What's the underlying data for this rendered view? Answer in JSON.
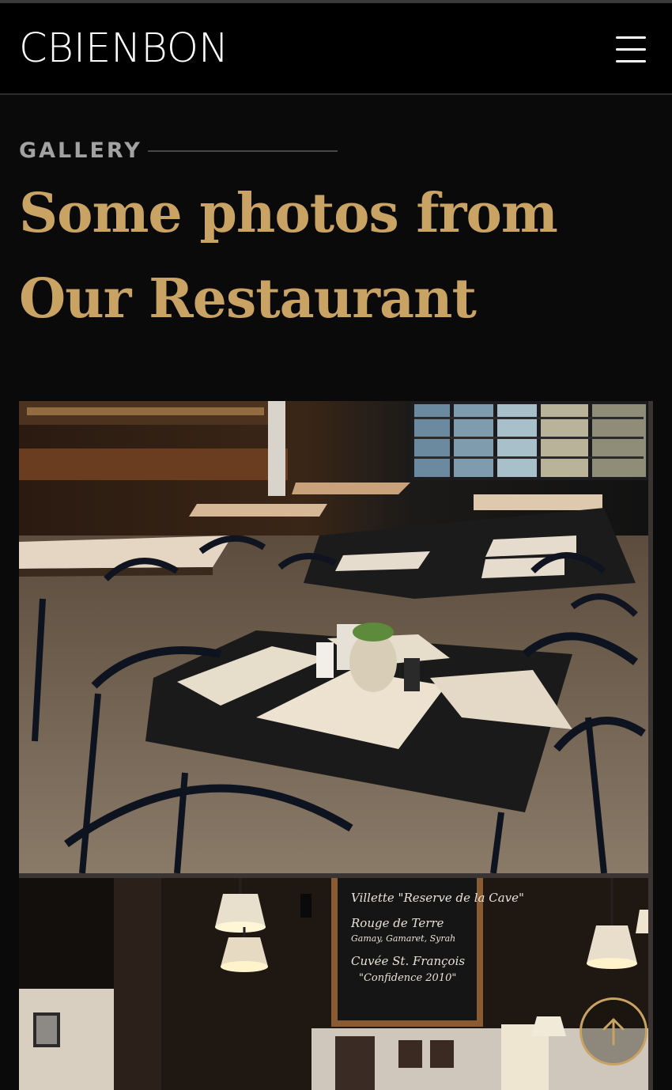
{
  "header": {
    "logo_text": "CBIENBON",
    "menu_icon": "hamburger-menu-icon"
  },
  "gallery_section": {
    "label": "GALLERY",
    "title": "Some photos from Our Restaurant",
    "photos": [
      {
        "alt": "Restaurant dining room with black tables, chairs and paper menus"
      },
      {
        "alt": "Restaurant interior with hanging lamps and chalkboard menu",
        "chalkboard_lines": [
          "Villette \"Reserve de la Cave\"",
          "Rouge de Terre",
          "Gamay, Gamaret, Syrah",
          "Cuvée St. François",
          "\"Confidence 2010\""
        ]
      }
    ]
  },
  "scroll_top": {
    "icon": "arrow-up-icon"
  },
  "colors": {
    "accent": "#c9a364",
    "background": "#0b0a0a",
    "header_bg": "#000000",
    "label_gray": "#a3a2a2"
  }
}
